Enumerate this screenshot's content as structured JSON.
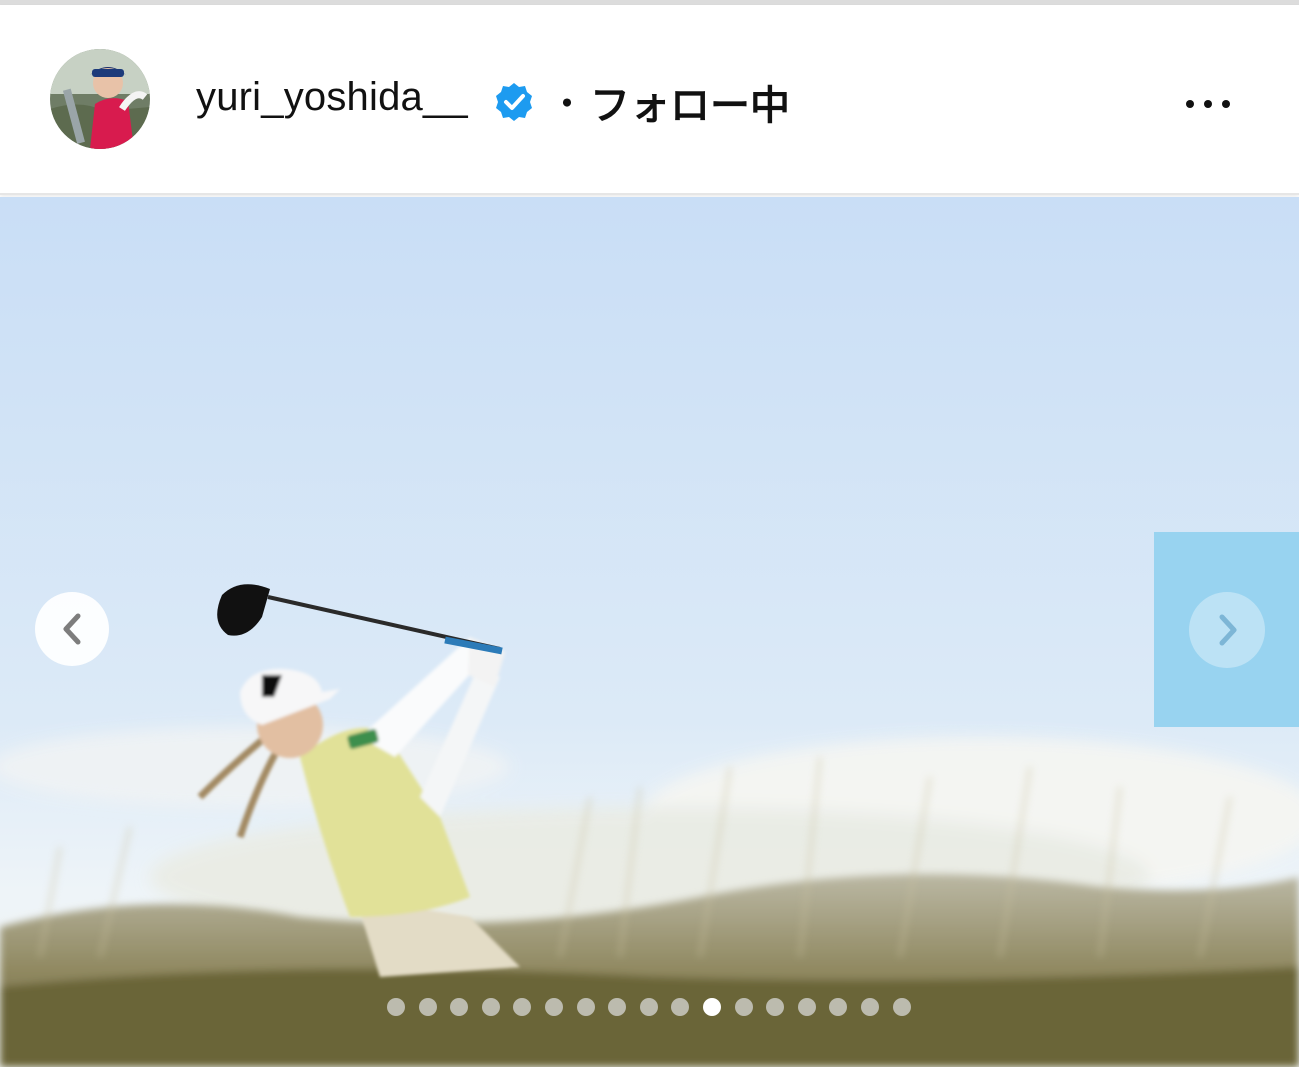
{
  "post_header": {
    "username": "yuri_yoshida__",
    "verified": true,
    "separator": "・",
    "follow_status": "フォロー中",
    "more_icon": "more-horizontal-icon"
  },
  "carousel": {
    "prev_icon": "chevron-left-icon",
    "next_icon": "chevron-right-icon",
    "total_slides": 17,
    "active_slide": 11
  },
  "colors": {
    "verified_badge": "#1d9bf0",
    "sky_top": "#c9def6",
    "sky_bottom": "#e8f2fa",
    "next_highlight": "#98d3f0"
  }
}
